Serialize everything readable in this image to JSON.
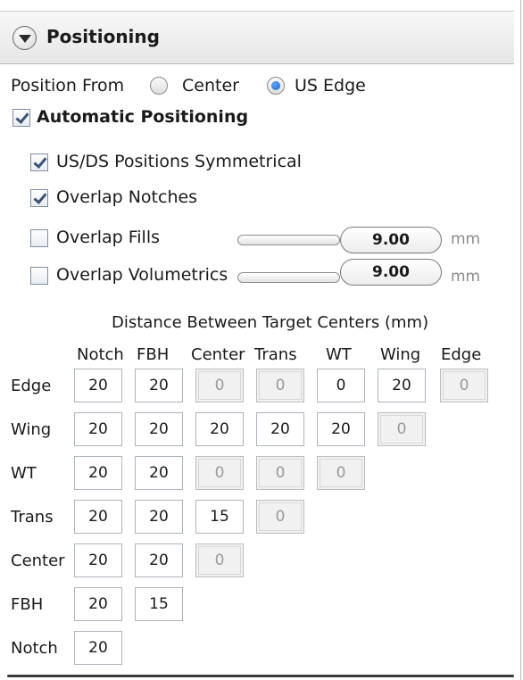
{
  "header": {
    "title": "Positioning",
    "icon": "collapse-chevron-icon"
  },
  "position_from": {
    "label": "Position From",
    "options": [
      "Center",
      "US Edge"
    ],
    "selected": "US Edge"
  },
  "automatic_positioning": {
    "label": "Automatic Positioning",
    "checked": true
  },
  "options": [
    {
      "label": "US/DS Positions Symmetrical",
      "checked": true
    },
    {
      "label": "Overlap Notches",
      "checked": true
    },
    {
      "label": "Overlap Fills",
      "checked": false,
      "value": "9.00",
      "unit": "mm"
    },
    {
      "label": "Overlap Volumetrics",
      "checked": false,
      "value": "9.00",
      "unit": "mm"
    }
  ],
  "matrix": {
    "title": "Distance Between Target Centers (mm)",
    "columns": [
      "Notch",
      "FBH",
      "Center",
      "Trans",
      "WT",
      "Wing",
      "Edge"
    ],
    "rows": [
      {
        "label": "Edge",
        "cells": [
          {
            "v": "20"
          },
          {
            "v": "20"
          },
          {
            "v": "0",
            "dis": true
          },
          {
            "v": "0",
            "dis": true
          },
          {
            "v": "0"
          },
          {
            "v": "20"
          },
          {
            "v": "0",
            "dis": true
          }
        ]
      },
      {
        "label": "Wing",
        "cells": [
          {
            "v": "20"
          },
          {
            "v": "20"
          },
          {
            "v": "20"
          },
          {
            "v": "20"
          },
          {
            "v": "20"
          },
          {
            "v": "0",
            "dis": true
          }
        ]
      },
      {
        "label": "WT",
        "cells": [
          {
            "v": "20"
          },
          {
            "v": "20"
          },
          {
            "v": "0",
            "dis": true
          },
          {
            "v": "0",
            "dis": true
          },
          {
            "v": "0",
            "dis": true
          }
        ]
      },
      {
        "label": "Trans",
        "cells": [
          {
            "v": "20"
          },
          {
            "v": "20"
          },
          {
            "v": "15"
          },
          {
            "v": "0",
            "dis": true
          }
        ]
      },
      {
        "label": "Center",
        "cells": [
          {
            "v": "20"
          },
          {
            "v": "20"
          },
          {
            "v": "0",
            "dis": true
          }
        ]
      },
      {
        "label": "FBH",
        "cells": [
          {
            "v": "20"
          },
          {
            "v": "15"
          }
        ]
      },
      {
        "label": "Notch",
        "cells": [
          {
            "v": "20"
          }
        ]
      }
    ]
  }
}
